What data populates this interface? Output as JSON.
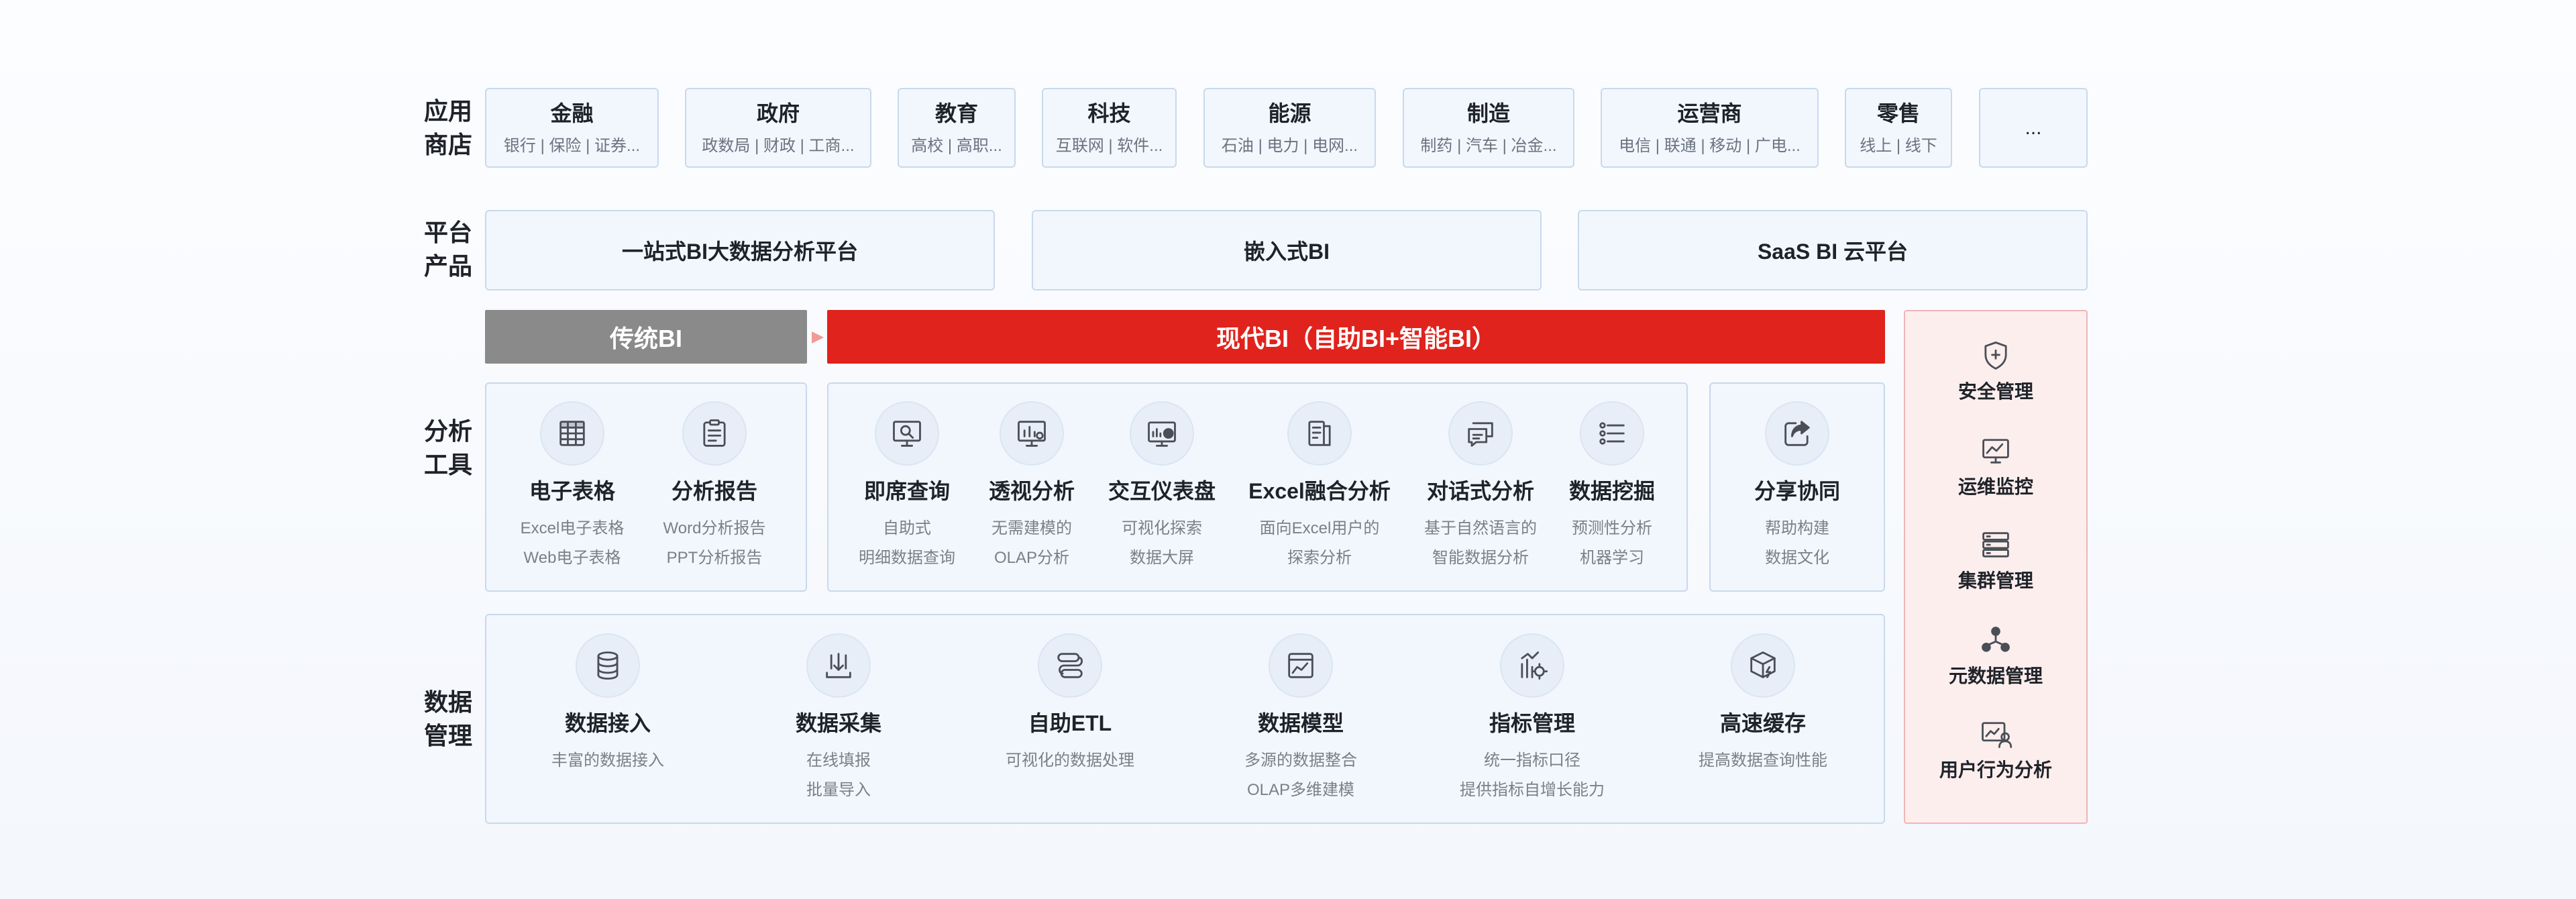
{
  "row_labels": {
    "app_store": "应用\n商店",
    "platform": "平台\n产品",
    "analysis": "分析\n工具",
    "data_mgmt": "数据\n管理"
  },
  "industries": [
    {
      "name": "金融",
      "sub": "银行 | 保险 | 证券..."
    },
    {
      "name": "政府",
      "sub": "政数局 | 财政 | 工商..."
    },
    {
      "name": "教育",
      "sub": "高校 | 高职..."
    },
    {
      "name": "科技",
      "sub": "互联网 | 软件..."
    },
    {
      "name": "能源",
      "sub": "石油 | 电力 | 电网..."
    },
    {
      "name": "制造",
      "sub": "制药 | 汽车 | 冶金..."
    },
    {
      "name": "运营商",
      "sub": "电信 | 联通 | 移动 | 广电..."
    },
    {
      "name": "零售",
      "sub": "线上 | 线下"
    },
    {
      "name": "...",
      "sub": ""
    }
  ],
  "platforms": [
    "一站式BI大数据分析平台",
    "嵌入式BI",
    "SaaS BI 云平台"
  ],
  "banners": {
    "traditional": "传统BI",
    "modern": "现代BI（自助BI+智能BI）"
  },
  "traditional_tools": [
    {
      "name": "电子表格",
      "desc": "Excel电子表格\nWeb电子表格",
      "icon": "table-icon"
    },
    {
      "name": "分析报告",
      "desc": "Word分析报告\nPPT分析报告",
      "icon": "report-icon"
    }
  ],
  "modern_tools": [
    {
      "name": "即席查询",
      "desc": "自助式\n明细数据查询",
      "icon": "query-icon"
    },
    {
      "name": "透视分析",
      "desc": "无需建模的\nOLAP分析",
      "icon": "pivot-icon"
    },
    {
      "name": "交互仪表盘",
      "desc": "可视化探索\n数据大屏",
      "icon": "dashboard-icon"
    },
    {
      "name": "Excel融合分析",
      "desc": "面向Excel用户的\n探索分析",
      "icon": "excel-icon"
    },
    {
      "name": "对话式分析",
      "desc": "基于自然语言的\n智能数据分析",
      "icon": "chat-icon"
    },
    {
      "name": "数据挖掘",
      "desc": "预测性分析\n机器学习",
      "icon": "mining-icon"
    }
  ],
  "share_tool": {
    "name": "分享协同",
    "desc": "帮助构建\n数据文化",
    "icon": "share-icon"
  },
  "data_tools": [
    {
      "name": "数据接入",
      "desc": "丰富的数据接入",
      "icon": "database-icon"
    },
    {
      "name": "数据采集",
      "desc": "在线填报\n批量导入",
      "icon": "collect-icon"
    },
    {
      "name": "自助ETL",
      "desc": "可视化的数据处理",
      "icon": "etl-icon"
    },
    {
      "name": "数据模型",
      "desc": "多源的数据整合\nOLAP多维建模",
      "icon": "model-icon"
    },
    {
      "name": "指标管理",
      "desc": "统一指标口径\n提供指标自增长能力",
      "icon": "metric-icon"
    },
    {
      "name": "高速缓存",
      "desc": "提高数据查询性能",
      "icon": "cache-icon"
    }
  ],
  "side_items": [
    {
      "name": "安全管理",
      "icon": "shield-icon"
    },
    {
      "name": "运维监控",
      "icon": "monitor-icon"
    },
    {
      "name": "集群管理",
      "icon": "server-icon"
    },
    {
      "name": "元数据管理",
      "icon": "metadata-icon"
    },
    {
      "name": "用户行为分析",
      "icon": "user-analysis-icon"
    }
  ],
  "colors": {
    "traditional_banner": "#8a8a8a",
    "modern_banner": "#e0231c",
    "card_bg": "#f2f7fd",
    "card_border": "#c8d9ee",
    "side_bg": "#fdeeee",
    "side_border": "#f1b5b5",
    "icon_stroke": "#4a4f57"
  }
}
